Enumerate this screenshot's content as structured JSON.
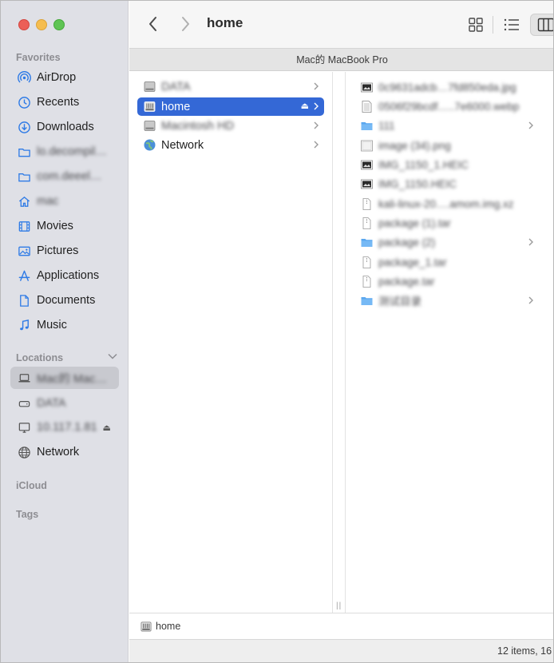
{
  "window": {
    "title": "home",
    "path_header": "Mac的 MacBook Pro"
  },
  "sidebar": {
    "favorites_title": "Favorites",
    "favorites": [
      {
        "label": "AirDrop",
        "icon": "airdrop-icon",
        "blurred": false
      },
      {
        "label": "Recents",
        "icon": "clock-icon",
        "blurred": false
      },
      {
        "label": "Downloads",
        "icon": "download-icon",
        "blurred": false
      },
      {
        "label": "lo.decompil…",
        "icon": "folder-icon",
        "blurred": true
      },
      {
        "label": "com.deeel…",
        "icon": "folder-icon",
        "blurred": true
      },
      {
        "label": "mac",
        "icon": "home-icon",
        "blurred": true
      },
      {
        "label": "Movies",
        "icon": "film-icon",
        "blurred": false
      },
      {
        "label": "Pictures",
        "icon": "picture-icon",
        "blurred": false
      },
      {
        "label": "Applications",
        "icon": "applications-icon",
        "blurred": false
      },
      {
        "label": "Documents",
        "icon": "document-icon",
        "blurred": false
      },
      {
        "label": "Music",
        "icon": "music-note-icon",
        "blurred": false
      }
    ],
    "locations_title": "Locations",
    "locations": [
      {
        "label": "Mac的 Mac…",
        "icon": "laptop-icon",
        "blurred": true,
        "selected": true
      },
      {
        "label": "DATA",
        "icon": "drive-icon",
        "blurred": true
      },
      {
        "label": "10.117.1.81",
        "icon": "display-icon",
        "blurred": true,
        "eject": "⏏"
      },
      {
        "label": "Network",
        "icon": "globe-icon",
        "blurred": false
      }
    ],
    "icloud_title": "iCloud",
    "tags_title": "Tags"
  },
  "column1": [
    {
      "label": "DATA",
      "icon": "hard-disk-icon",
      "blurred": true,
      "chevron": true
    },
    {
      "label": "home",
      "icon": "network-drive-icon",
      "blurred": false,
      "selected": true,
      "eject": "⏏",
      "chevron": true
    },
    {
      "label": "Macintosh HD",
      "icon": "hard-disk-icon",
      "blurred": true,
      "chevron": true
    },
    {
      "label": "Network",
      "icon": "network-globe-icon",
      "blurred": false,
      "chevron": true
    }
  ],
  "column2": [
    {
      "label": "0c9631adcb…7fd850eda.jpg",
      "icon": "image-file-icon",
      "blurred": true
    },
    {
      "label": "0506f29bcdf…..7e6000.webp",
      "icon": "webp-file-icon",
      "blurred": true
    },
    {
      "label": "111",
      "icon": "folder-icon",
      "blurred": true,
      "chevron": true
    },
    {
      "label": "image (34).png",
      "icon": "image-file-icon",
      "blurred": true
    },
    {
      "label": "IMG_1150_1.HEIC",
      "icon": "image-file-icon",
      "blurred": true
    },
    {
      "label": "IMG_1150.HEIC",
      "icon": "image-file-icon",
      "blurred": true
    },
    {
      "label": "kali-linux-20….amom.img.xz",
      "icon": "file-icon",
      "blurred": true
    },
    {
      "label": "package (1).tar",
      "icon": "file-icon",
      "blurred": true
    },
    {
      "label": "package (2)",
      "icon": "folder-icon",
      "blurred": true,
      "chevron": true
    },
    {
      "label": "package_1.tar",
      "icon": "file-icon",
      "blurred": true
    },
    {
      "label": "package.tar",
      "icon": "file-icon",
      "blurred": true
    },
    {
      "label": "测试目录",
      "icon": "folder-icon",
      "blurred": true,
      "chevron": true
    }
  ],
  "pathbar": {
    "label": "home"
  },
  "status": {
    "text": "12 items, 16"
  },
  "colors": {
    "accent": "#3468d6",
    "sidebar_bg": "#dfe0e6",
    "icon_blue": "#2f7be6"
  }
}
